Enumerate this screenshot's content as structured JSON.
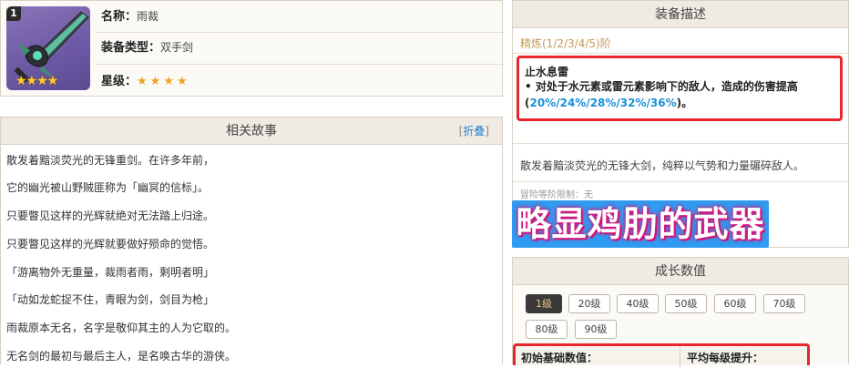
{
  "weapon": {
    "badge": "1",
    "thumb_stars": "★★★★",
    "name_key": "名称：",
    "name_value": "雨裁",
    "type_key": "装备类型：",
    "type_value": "双手剑",
    "rarity_key": "星级：",
    "rarity_stars": "★★★★",
    "rarity": 4
  },
  "story": {
    "title": "相关故事",
    "fold_left": "[",
    "fold_label": "折叠",
    "fold_right": "]",
    "lines": [
      "散发着黯淡荧光的无锋重剑。在许多年前，",
      "它的幽光被山野贼匪称为「幽冥的信标」。",
      "只要瞥见这样的光辉就绝对无法踏上归途。",
      "只要瞥见这样的光辉就要做好殒命的觉悟。",
      "「游离物外无重量，裁雨者雨，剩明者明」",
      "「动如龙蛇捉不住，青眼为剑，剑目为枪」",
      "雨裁原本无名，名字是敬仰其主的人为它取的。",
      "无名剑的最初与最后主人，是名唤古华的游侠。"
    ]
  },
  "description": {
    "title": "装备描述",
    "refine": "精炼(1/2/3/4/5)阶",
    "skill_name": "止水息雷",
    "skill_text_prefix": "• 对处于水元素或雷元素影响下的敌人，造成的伤害提高(",
    "skill_text_values": "20%/24%/28%/32%/36%",
    "skill_text_suffix": ")。",
    "flavor": "散发着黯淡荧光的无锋大剑，纯粹以气势和力量碾碎敌人。",
    "limit": "冒险等阶限制：无"
  },
  "overlay_text": "略显鸡肋的武器",
  "growth": {
    "title": "成长数值",
    "levels": [
      "1级",
      "20级",
      "40级",
      "50级",
      "60级",
      "70级",
      "80级",
      "90级"
    ],
    "selected_level": "1级",
    "col_base": "初始基础数值：",
    "col_per_level": "平均每级提升："
  },
  "colors": {
    "highlight_border": "#e8262d",
    "link": "#2a7fd1",
    "value_highlight": "#1b8fd8",
    "overlay_bg": "#2f9cf2",
    "overlay_glow": "#d3157a",
    "refine_text": "#c49a57"
  }
}
